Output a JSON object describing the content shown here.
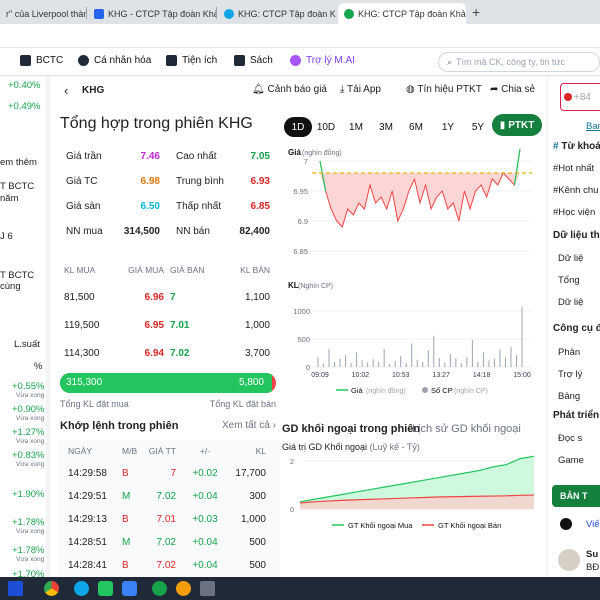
{
  "browser": {
    "tabs": [
      {
        "label": "r\" của Liverpool thành tr",
        "active": false
      },
      {
        "label": "KHG - CTCP Tập đoàn Khải Hoàn",
        "active": false
      },
      {
        "label": "KHG: CTCP Tập đoàn Khải Hoàn",
        "active": false
      },
      {
        "label": "KHG: CTCP Tập đoàn Khải H",
        "active": true
      }
    ]
  },
  "nav": {
    "items": [
      "BCTC",
      "Cá nhân hóa",
      "Tiện ích",
      "Sách",
      "Trợ lý M.AI"
    ],
    "search_placeholder": "Tìm mã CK, công ty, tin tức"
  },
  "left_panel": {
    "pct1": "+0.40%",
    "pct2": "+0.49%",
    "link": "em thêm",
    "text1a": "T BCTC",
    "text1b": "năm",
    "text2": "J 6",
    "text3a": "T BCTC",
    "text3b": "cùng",
    "col_header": "L.suất",
    "col_unit": "%",
    "rows": [
      {
        "pct": "+0.55%",
        "note": "Vừa xong"
      },
      {
        "pct": "+0.90%",
        "note": "Vừa xong"
      },
      {
        "pct": "+1.27%",
        "note": "Vừa xong"
      },
      {
        "pct": "+0.83%",
        "note": "Vừa xong"
      },
      {
        "pct": "+1.90%",
        "note": ""
      },
      {
        "pct": "+1.78%",
        "note": "Vừa xong"
      },
      {
        "pct": "+1.78%",
        "note": "Vừa xong"
      },
      {
        "pct": "+1.70%",
        "note": ""
      }
    ]
  },
  "header": {
    "ticker": "KHG",
    "actions": [
      "Cảnh báo giá",
      "Tải App",
      "Tín hiệu PTKT",
      "Chia sẻ"
    ]
  },
  "summary": {
    "title": "Tổng hợp trong phiên KHG",
    "periods": [
      "1D",
      "10D",
      "1M",
      "3M",
      "6M",
      "1Y",
      "5Y"
    ],
    "active_period": "1D",
    "ptkt": "PTKT",
    "stats": [
      {
        "label": "Giá trần",
        "value": "7.46",
        "label2": "Cao nhất",
        "value2": "7.05"
      },
      {
        "label": "Giá TC",
        "value": "6.98",
        "label2": "Trung bình",
        "value2": "6.93"
      },
      {
        "label": "Giá sàn",
        "value": "6.50",
        "label2": "Thấp nhất",
        "value2": "6.85"
      },
      {
        "label": "NN mua",
        "value": "314,500",
        "label2": "NN bán",
        "value2": "82,400"
      }
    ]
  },
  "orderbook": {
    "headers": [
      "KL MUA",
      "GIÁ MUA",
      "GIÁ BÁN",
      "KL BÁN"
    ],
    "rows": [
      {
        "kl_mua": "81,500",
        "gia_mua": "6.96",
        "gia_ban": "7",
        "kl_ban": "1,100"
      },
      {
        "kl_mua": "119,500",
        "gia_mua": "6.95",
        "gia_ban": "7.01",
        "kl_ban": "1,000"
      },
      {
        "kl_mua": "114,300",
        "gia_mua": "6.94",
        "gia_ban": "7.02",
        "kl_ban": "3,700"
      }
    ],
    "total_buy": "315,300",
    "total_sell": "5,800",
    "total_buy_ratio": 0.982,
    "total_buy_label": "Tổng KL đặt mua",
    "total_sell_label": "Tổng KL đặt bán"
  },
  "matched": {
    "title": "Khớp lệnh trong phiên",
    "see_all": "Xem tất cả",
    "headers": [
      "NGÀY",
      "M/B",
      "GIÁ TT",
      "+/-",
      "KL"
    ],
    "rows": [
      {
        "time": "14:29:58",
        "side": "B",
        "price": "7",
        "change": "+0.02",
        "vol": "17,700"
      },
      {
        "time": "14:29:51",
        "side": "M",
        "price": "7.02",
        "change": "+0.04",
        "vol": "300"
      },
      {
        "time": "14:29:13",
        "side": "B",
        "price": "7.01",
        "change": "+0.03",
        "vol": "1,000"
      },
      {
        "time": "14:28:51",
        "side": "M",
        "price": "7.02",
        "change": "+0.04",
        "vol": "500"
      },
      {
        "time": "14:28:41",
        "side": "B",
        "price": "7.02",
        "change": "+0.04",
        "vol": "500"
      }
    ]
  },
  "price_chart": {
    "label": "Giá",
    "unit": "(nghìn đồng)",
    "yticks": [
      "7",
      "6.95",
      "6.9",
      "6.85"
    ]
  },
  "volume_chart": {
    "label": "KL",
    "unit": "(Nghìn CP)",
    "yticks": [
      "1000",
      "500",
      "0"
    ],
    "xticks": [
      "09:09",
      "10:02",
      "10:53",
      "13:27",
      "14:18",
      "15:00"
    ],
    "legend_price": "Giá",
    "legend_price_unit": "(nghìn đồng)",
    "legend_vol": "Số CP",
    "legend_vol_unit": "(nghìn CP)"
  },
  "foreign": {
    "title": "GD khối ngoại trong phiên",
    "history": "Lịch sử GD khối ngoại",
    "subtitle": "Giá trị GD Khối ngoại",
    "subtitle_unit": "(Luỹ kế - Tỷ)",
    "yticks": [
      "2",
      "0"
    ],
    "legend_buy": "GT Khối ngoại Mua",
    "legend_sell": "GT Khối ngoại Bán"
  },
  "right_panel": {
    "top_text": "+84",
    "link": "Ban",
    "h1": "Từ khoá",
    "tags": [
      "#Hot nhất",
      "#Kênh chu",
      "#Học viện"
    ],
    "h2": "Dữ liệu thị",
    "items2": [
      "Dữ liệ",
      "Tổng",
      "Dữ liệ"
    ],
    "h3": "Công cụ đ",
    "items3": [
      "Phân",
      "Trợ lý",
      "Bảng"
    ],
    "h4": "Phát triển",
    "items4": [
      "Đọc s",
      "Game"
    ],
    "ban_btn": "BẢN T",
    "vie": "Viế",
    "su": "Su",
    "bd": "BĐ"
  },
  "chart_data": [
    {
      "type": "line",
      "title": "Giá",
      "ylabel": "(nghìn đồng)",
      "ylim": [
        6.85,
        7.0
      ],
      "reference_price": 6.98,
      "x": [
        "09:09",
        "10:02",
        "10:53",
        "13:27",
        "14:18",
        "15:00"
      ],
      "values": [
        7.0,
        6.95,
        6.92,
        6.9,
        6.89,
        6.92,
        6.91,
        6.93,
        6.92,
        6.96,
        6.93,
        6.94,
        6.92,
        6.95,
        6.9,
        6.92,
        6.95,
        6.97,
        6.93,
        6.96,
        6.92,
        6.94,
        6.95,
        6.92,
        6.93,
        6.9,
        6.95,
        6.92,
        6.95,
        6.96,
        6.94,
        6.97,
        6.96,
        6.98,
        6.97,
        6.96,
        7.02
      ]
    },
    {
      "type": "bar",
      "title": "KL",
      "ylabel": "(Nghìn CP)",
      "ylim": [
        0,
        1000
      ],
      "x": [
        "09:09",
        "10:02",
        "10:53",
        "13:27",
        "14:18",
        "15:00"
      ],
      "values": [
        180,
        60,
        320,
        90,
        150,
        210,
        70,
        260,
        120,
        80,
        140,
        95,
        320,
        60,
        110,
        200,
        75,
        420,
        130,
        90,
        300,
        560,
        160,
        80,
        230,
        150,
        70,
        180,
        480,
        90,
        260,
        120,
        150,
        320,
        170,
        360,
        210,
        1080
      ]
    },
    {
      "type": "area",
      "title": "Giá trị GD Khối ngoại",
      "ylabel": "(Luỹ kế - Tỷ)",
      "ylim": [
        0,
        2
      ],
      "series": [
        {
          "name": "GT Khối ngoại Mua",
          "values": [
            0.3,
            0.4,
            0.5,
            0.6,
            0.7,
            0.8,
            0.9,
            1.0,
            1.1,
            1.2,
            1.3,
            1.4,
            1.5,
            1.6,
            1.75,
            1.85,
            2.1,
            2.2
          ]
        },
        {
          "name": "GT Khối ngoại Bán",
          "values": [
            0.25,
            0.3,
            0.33,
            0.36,
            0.38,
            0.4,
            0.42,
            0.44,
            0.46,
            0.48,
            0.5,
            0.51,
            0.52,
            0.53,
            0.54,
            0.55,
            0.57,
            0.58
          ]
        }
      ]
    }
  ]
}
